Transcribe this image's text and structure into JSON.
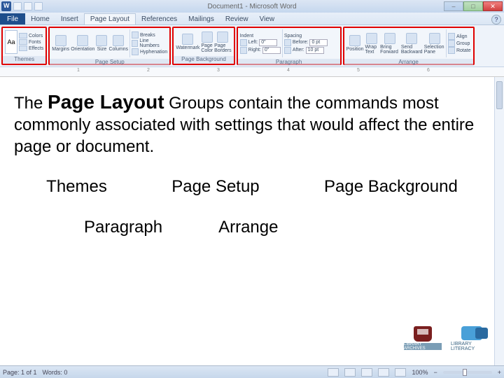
{
  "titlebar": {
    "title": "Document1 - Microsoft Word"
  },
  "tabs": {
    "file": "File",
    "home": "Home",
    "insert": "Insert",
    "page_layout": "Page Layout",
    "references": "References",
    "mailings": "Mailings",
    "review": "Review",
    "view": "View"
  },
  "ribbon": {
    "themes": {
      "label": "Themes",
      "btn": "Themes",
      "colors": "Colors",
      "fonts": "Fonts",
      "effects": "Effects"
    },
    "page_setup": {
      "label": "Page Setup",
      "margins": "Margins",
      "orientation": "Orientation",
      "size": "Size",
      "columns": "Columns",
      "breaks": "Breaks",
      "line_numbers": "Line Numbers",
      "hyphenation": "Hyphenation"
    },
    "page_background": {
      "label": "Page Background",
      "watermark": "Watermark",
      "page_color": "Page Color",
      "page_borders": "Page Borders"
    },
    "paragraph": {
      "label": "Paragraph",
      "indent": "Indent",
      "spacing": "Spacing",
      "left": "Left:",
      "right": "Right:",
      "before": "Before:",
      "after": "After:",
      "left_val": "0\"",
      "right_val": "0\"",
      "before_val": "0 pt",
      "after_val": "10 pt"
    },
    "arrange": {
      "label": "Arrange",
      "position": "Position",
      "wrap": "Wrap Text",
      "bring": "Bring Forward",
      "send": "Send Backward",
      "selection": "Selection Pane",
      "align": "Align",
      "group": "Group",
      "rotate": "Rotate"
    }
  },
  "ruler": {
    "n1": "1",
    "n2": "2",
    "n3": "3",
    "n4": "4",
    "n5": "5",
    "n6": "6"
  },
  "doc": {
    "para_pre": "The ",
    "para_bold": "Page Layout",
    "para_post": " Groups contain the commands most commonly associated with settings that would affect the entire page or document.",
    "themes": "Themes",
    "page_setup": "Page Setup",
    "page_bg": "Page Background",
    "paragraph": "Paragraph",
    "arrange": "Arrange"
  },
  "status": {
    "page": "Page: 1 of 1",
    "words": "Words: 0",
    "zoom": "100%"
  },
  "logos": {
    "la": "LIBRARY ARCHIVES",
    "ll": "LIBRARY LITERACY"
  }
}
